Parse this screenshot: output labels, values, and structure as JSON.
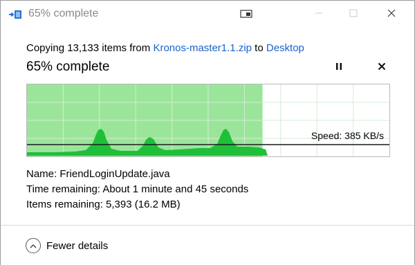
{
  "window": {
    "title": "65% complete"
  },
  "copy": {
    "prefix": "Copying 13,133 items from",
    "source": "Kronos-master1.1.zip",
    "to_word": "to",
    "destination": "Desktop"
  },
  "progress": {
    "heading": "65% complete",
    "fraction": 0.65
  },
  "graph": {
    "speed_label": "Speed: 385 KB/s"
  },
  "details": {
    "name_label": "Name:",
    "name_value": "FriendLoginUpdate.java",
    "time_label": "Time remaining:",
    "time_value": "About 1 minute and 45 seconds",
    "items_label": "Items remaining:",
    "items_value": "5,393 (16.2 MB)"
  },
  "footer": {
    "toggle_label": "Fewer details"
  },
  "icons": {
    "app": "copy-files-icon",
    "compact": "compact-view-icon",
    "minimize": "minimize-icon",
    "maximize": "maximize-icon",
    "close": "close-icon",
    "pause": "pause-icon",
    "cancel": "cancel-icon",
    "collapse": "chevron-up-circle-icon"
  },
  "colors": {
    "link": "#1a63c9",
    "progress_fill": "#9be59b",
    "graph_area": "#1fbf3a",
    "title_gray": "#8a8a8a"
  }
}
